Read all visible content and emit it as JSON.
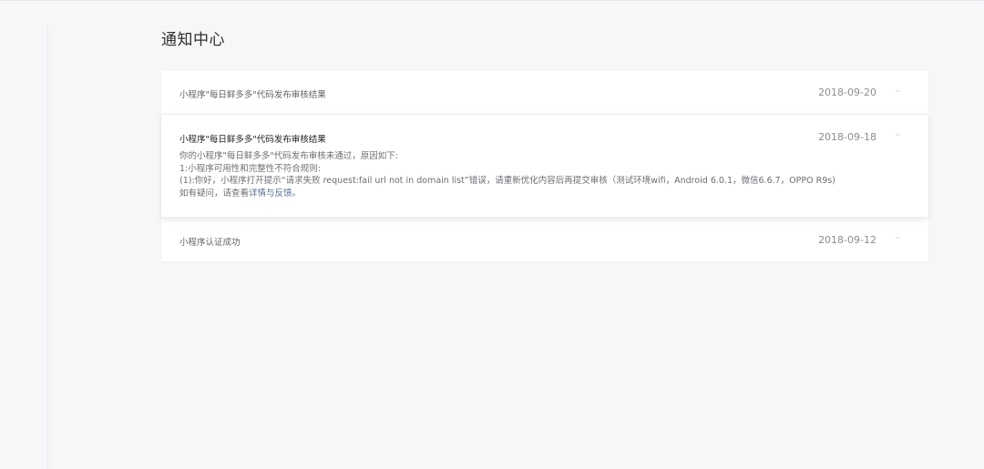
{
  "page": {
    "title": "通知中心"
  },
  "notifications": [
    {
      "title": "小程序\"每日鲜多多\"代码发布审核结果",
      "date": "2018-09-20",
      "toggle_icon": "chevron-down-icon"
    },
    {
      "title": "小程序\"每日鲜多多\"代码发布审核结果",
      "date": "2018-09-18",
      "toggle_icon": "chevron-up-icon",
      "body": {
        "line1": "你的小程序\"每日鲜多多\"代码发布审核未通过，原因如下:",
        "line2": "1:小程序可用性和完整性不符合规则:",
        "line3": "(1):你好，小程序打开提示“请求失败 request:fail url not in domain list”错误，请重新优化内容后再提交审核（测试环境wifi，Android 6.0.1，微信6.6.7，OPPO R9s)",
        "line4_prefix": "如有疑问，请查看",
        "line4_link": "详情与反馈。"
      }
    },
    {
      "title": "小程序认证成功",
      "date": "2018-09-12",
      "toggle_icon": "chevron-down-icon"
    }
  ],
  "colors": {
    "background": "#f6f7f9",
    "card": "#ffffff",
    "link": "#576b95"
  }
}
